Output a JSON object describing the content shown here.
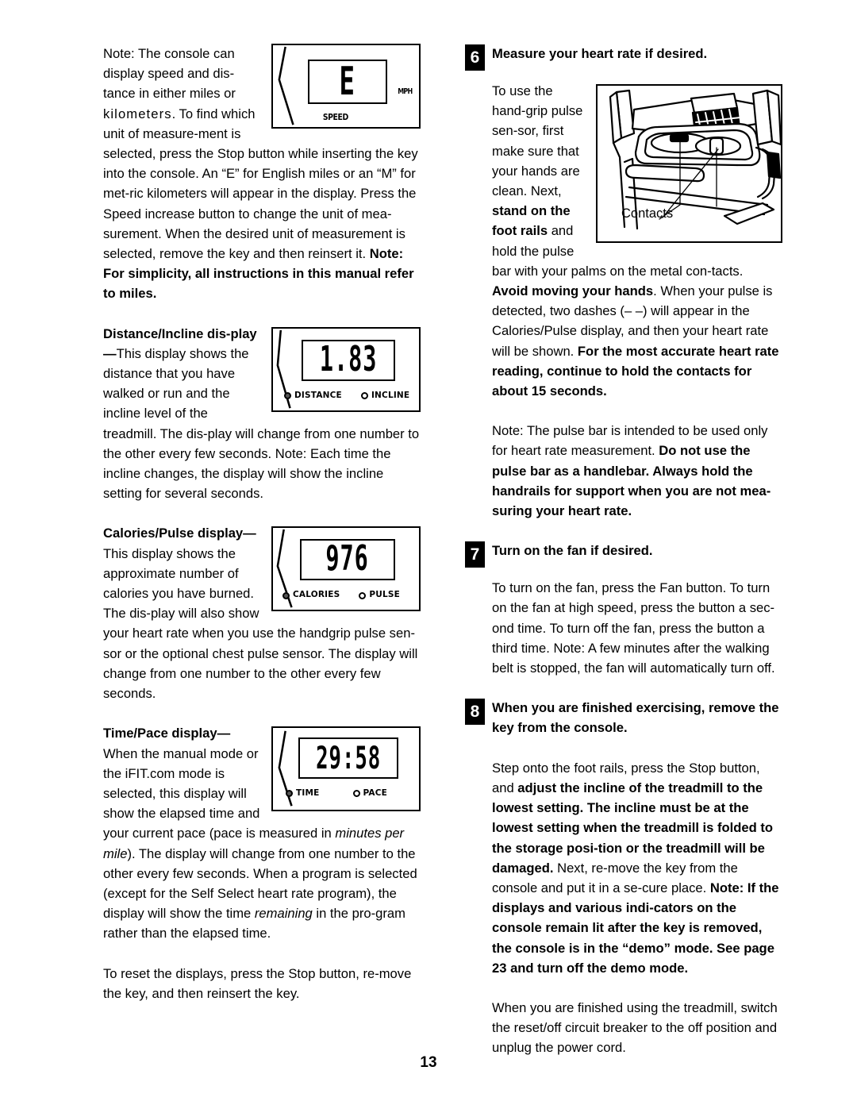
{
  "page": {
    "number": "13"
  },
  "left_column": {
    "note_console": {
      "text_part1": "Note: The console can display speed and dis-tance in either miles or ",
      "kilometers_word": "kilometers",
      "text_part2": ". To find which unit of measure-ment is selected, press the Stop button while inserting the key into the console. An “E” for English miles or an “M” for met-ric kilometers will appear in the display. Press the Speed increase button to change the unit of mea-surement. When the desired unit of measurement is selected, remove the key and then reinsert it. "
    },
    "note_simplicity": "Note: For simplicity, all instructions in this manual refer to miles.",
    "distance_incline": {
      "heading": "Distance/Incline dis-play",
      "dash": "—",
      "body": "This display shows the distance that you have walked or run and the incline level of the treadmill. The dis-play will change from one number to the other every few seconds. Note: Each time the incline changes, the display will show the incline setting for several seconds."
    },
    "calories_pulse": {
      "heading": "Calories/Pulse display",
      "dash": "—",
      "body": "This display shows the approximate number of calories you have burned. The dis-play will also show your heart rate when you use the handgrip pulse sen-sor or the optional chest pulse sensor. The display will change from one number to the other every few seconds."
    },
    "time_pace": {
      "heading": "Time/Pace display",
      "dash": "—",
      "body_a": "When the manual mode or the iFIT.com mode is selected, this display will show the elapsed time and your current pace (pace is measured in ",
      "italic_a": "minutes per mile",
      "body_b": "). The display will change from one number to the other every few seconds. When a program is selected (except for the Self Select heart rate program), the display will show the time ",
      "italic_b": "remaining",
      "body_c": " in the pro-gram rather than the elapsed time."
    },
    "reset_note": "To reset the displays, press the Stop button, re-move the key, and then reinsert the key."
  },
  "figures": {
    "speed_display": {
      "value": "E",
      "caption": "SPEED",
      "unit": "MPH"
    },
    "distance_display": {
      "value": "1.83",
      "indicator_1": "DISTANCE",
      "indicator_1_state": "filled",
      "indicator_2": "INCLINE",
      "indicator_2_state": "empty"
    },
    "calories_display": {
      "value": "976",
      "indicator_1": "CALORIES",
      "indicator_1_state": "filled",
      "indicator_2": "PULSE",
      "indicator_2_state": "empty"
    },
    "time_display": {
      "value": "29:58",
      "indicator_1": "TIME",
      "indicator_1_state": "filled",
      "indicator_2": "PACE",
      "indicator_2_state": "empty"
    },
    "treadmill_illustration": {
      "callout": "Contacts"
    }
  },
  "right_column": {
    "step6": {
      "number": "6",
      "title": "Measure your heart rate if desired.",
      "body_a": "To use the hand-grip pulse sen-sor, first make sure that your hands are clean. Next, ",
      "bold_a": "stand on the foot rails",
      "body_b": " and hold the pulse bar with your palms on the metal con-tacts. ",
      "bold_b": "Avoid moving your hands",
      "body_c": ". When your pulse is detected, two dashes (– –) will appear in the Calories/Pulse display, and then your heart rate will be shown. ",
      "bold_c": "For the most accurate heart rate reading, continue to hold the contacts for about 15 seconds.",
      "note_a": "Note: The pulse bar is intended to be used only for heart rate measurement. ",
      "note_bold": "Do not use the pulse bar as a handlebar. Always hold the handrails for support when you are not mea-suring your heart rate."
    },
    "step7": {
      "number": "7",
      "title": "Turn on the fan if desired.",
      "body": "To turn on the fan, press the Fan button. To turn on the fan at high speed, press the button a sec-ond time. To turn off the fan, press the button a third time. Note: A few minutes after the walking belt is stopped, the fan will automatically turn off."
    },
    "step8": {
      "number": "8",
      "title": "When you are finished exercising, remove the key from the console.",
      "body_a": "Step onto the foot rails, press the Stop button, and ",
      "bold_a": "adjust the incline of the treadmill to the lowest setting. The incline must be at the lowest setting when the treadmill is folded to the storage posi-tion or the treadmill will be damaged.",
      "body_b": " Next, re-move the key from the console and put it in a se-cure place. ",
      "bold_b": "Note: If the displays and various indi-cators on the console remain lit after the key is removed, the console is in the “demo” mode. See page 23 and turn off the demo mode.",
      "final": "When you are finished using the treadmill, switch the reset/off circuit breaker to the off position and unplug the power cord."
    }
  }
}
